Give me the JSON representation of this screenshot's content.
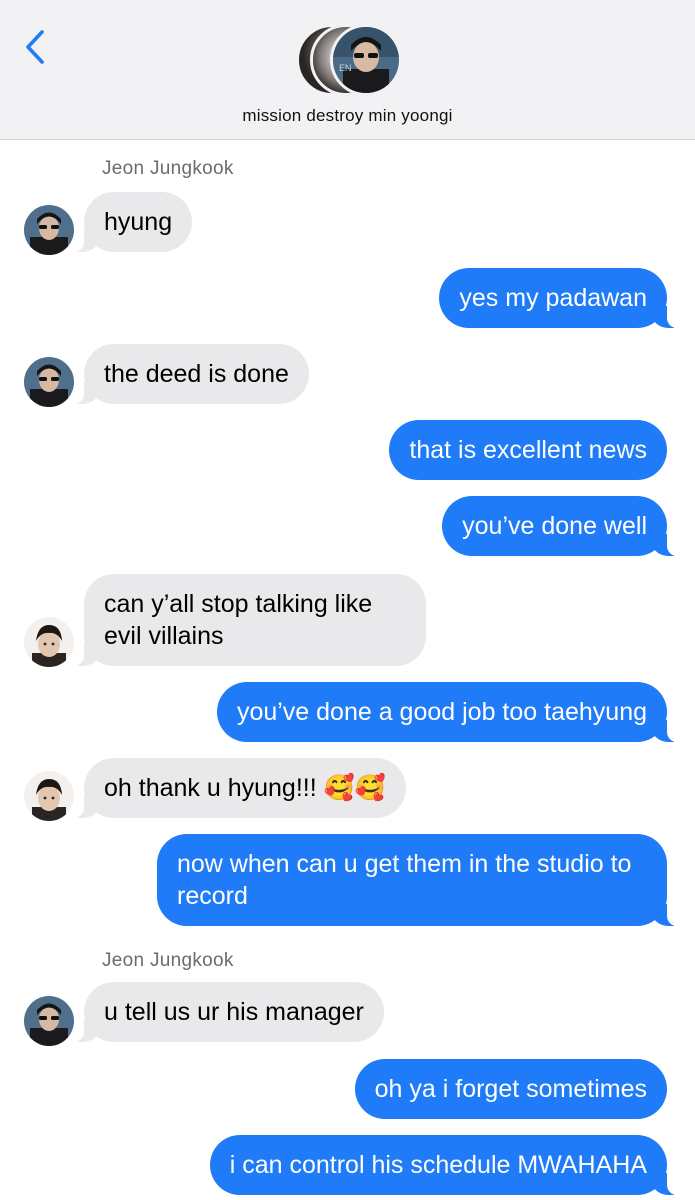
{
  "header": {
    "back_icon": "chevron-left-icon",
    "group_name": "mission destroy min yoongi",
    "accent_color": "#1f7bf7"
  },
  "messages": [
    {
      "side": "in",
      "sender": "Jeon Jungkook",
      "avatar": "jungkook-avatar",
      "text": "hyung"
    },
    {
      "side": "out",
      "text": "yes my padawan"
    },
    {
      "side": "in",
      "avatar": "jungkook-avatar",
      "text": "the deed is done"
    },
    {
      "side": "out",
      "text": "that is excellent news"
    },
    {
      "side": "out",
      "text": "you’ve done well"
    },
    {
      "side": "in",
      "avatar": "taehyung-avatar",
      "text": "can y’all stop talking like evil villains"
    },
    {
      "side": "out",
      "text": "you’ve done a good job too taehyung"
    },
    {
      "side": "in",
      "avatar": "taehyung-avatar",
      "text": "oh thank u hyung!!! 🥰🥰"
    },
    {
      "side": "out",
      "text": "now when can u get them in the studio to record"
    },
    {
      "side": "in",
      "sender": "Jeon Jungkook",
      "avatar": "jungkook-avatar",
      "text": "u tell us ur his manager"
    },
    {
      "side": "out",
      "text": "oh ya i forget sometimes"
    },
    {
      "side": "out",
      "text": "i can control his schedule MWAHAHA"
    }
  ],
  "colors": {
    "incoming_bubble": "#e9e9eb",
    "outgoing_bubble": "#1f7bf7",
    "header_bg": "#f2f2f4",
    "sender_name": "#6b6b70"
  }
}
